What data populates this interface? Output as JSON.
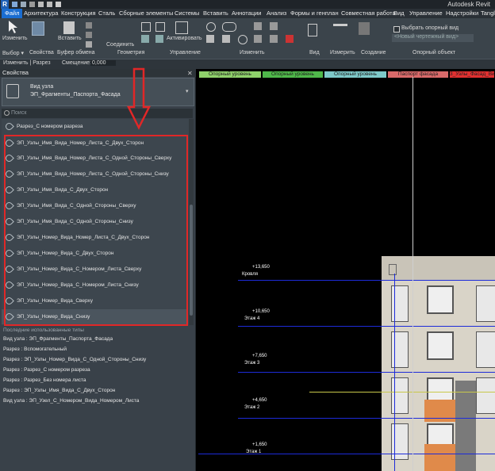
{
  "app": {
    "title": "Autodesk Revit",
    "logo": "R"
  },
  "menu": [
    "Файл",
    "Архитектура",
    "Конструкция",
    "Сталь",
    "Сборные элементы",
    "Системы",
    "Вставить",
    "Аннотации",
    "Анализ",
    "Формы и генплан",
    "Совместная работа",
    "Вид",
    "Управление",
    "Надстройки",
    "Tangl"
  ],
  "ribbon": {
    "groups": [
      "Выбор ▾",
      "Свойства",
      "Буфер обмена",
      "Геометрия",
      "Управление",
      "Изменить",
      "Вид",
      "Измерить",
      "Создание",
      "Опорный объект"
    ],
    "modify": "Изменить",
    "paste": "Вставить",
    "join": "Соединить",
    "activate": "Активировать",
    "ref_view_checkbox": "Выбрать опорный вид",
    "ref_view_select": "<Новый чертежный вид>"
  },
  "optionbar": {
    "context": "Изменить | Разрез",
    "offset_label": "Смещение:",
    "offset_value": "0,000"
  },
  "properties": {
    "header": "Свойства",
    "type_family": "Вид узла",
    "type_name": "ЭП_Фрагменты_Паспорта_Фасада",
    "search_placeholder": "Поиск",
    "items": [
      "Разрез_С номером разреза",
      "ЭП_Узлы_Имя_Вида_Номер_Листа_С_Двух_Сторон",
      "ЭП_Узлы_Имя_Вида_Номер_Листа_С_Одной_Стороны_Сверху",
      "ЭП_Узлы_Имя_Вида_Номер_Листа_С_Одной_Стороны_Снизу",
      "ЭП_Узлы_Имя_Вида_С_Двух_Сторон",
      "ЭП_Узлы_Имя_Вида_С_Одной_Стороны_Сверху",
      "ЭП_Узлы_Имя_Вида_С_Одной_Стороны_Снизу",
      "ЭП_Узлы_Номер_Вида_Номер_Листа_С_Двух_Сторон",
      "ЭП_Узлы_Номер_Вида_С_Двух_Сторон",
      "ЭП_Узлы_Номер_Вида_С_Номером_Листа_Сверху",
      "ЭП_Узлы_Номер_Вида_С_Номером_Листа_Снизу",
      "ЭП_Узлы_Номер_Вида_Сверху",
      "ЭП_Узлы_Номер_Вида_Снизу"
    ],
    "recent_header": "Последние использованные типы",
    "recent": [
      "Вид узла : ЭП_Фрагменты_Паспорта_Фасада",
      "Разрез : Вспомогательный",
      "Разрез : ЭП_Узлы_Номер_Вида_С_Одной_Стороны_Снизу",
      "Разрез : Разрез_С номером разреза",
      "Разрез : Разрез_Без номера листа",
      "Разрез : ЭП_Узлы_Имя_Вида_С_Двух_Сторон",
      "Вид узла : ЭП_Узел_С_Номером_Вида_Номером_Листа"
    ]
  },
  "canvas": {
    "levels": [
      {
        "label": "Опорный уровень",
        "color": "#8fd16b"
      },
      {
        "label": "Опорный уровень",
        "color": "#4fb84a"
      },
      {
        "label": "Опорный уровень",
        "color": "#7ec9c9"
      },
      {
        "label": "Паспорт фасада",
        "color": "#d96a6a"
      },
      {
        "label": "3_Узлы_Фасад_Вид",
        "color": "#e03030"
      }
    ],
    "marks": [
      {
        "elev": "+13,650",
        "name": "Кровля"
      },
      {
        "elev": "+10,650",
        "name": "Этаж 4"
      },
      {
        "elev": "+7,650",
        "name": "Этаж 3"
      },
      {
        "elev": "+4,650",
        "name": "Этаж 2"
      },
      {
        "elev": "+1,650",
        "name": "Этаж 1"
      }
    ]
  },
  "colors": {
    "highlight": "#e12727",
    "arrow": "#e12727",
    "blue_line": "#1d2bd9",
    "yellow_line": "#c8c84a"
  }
}
